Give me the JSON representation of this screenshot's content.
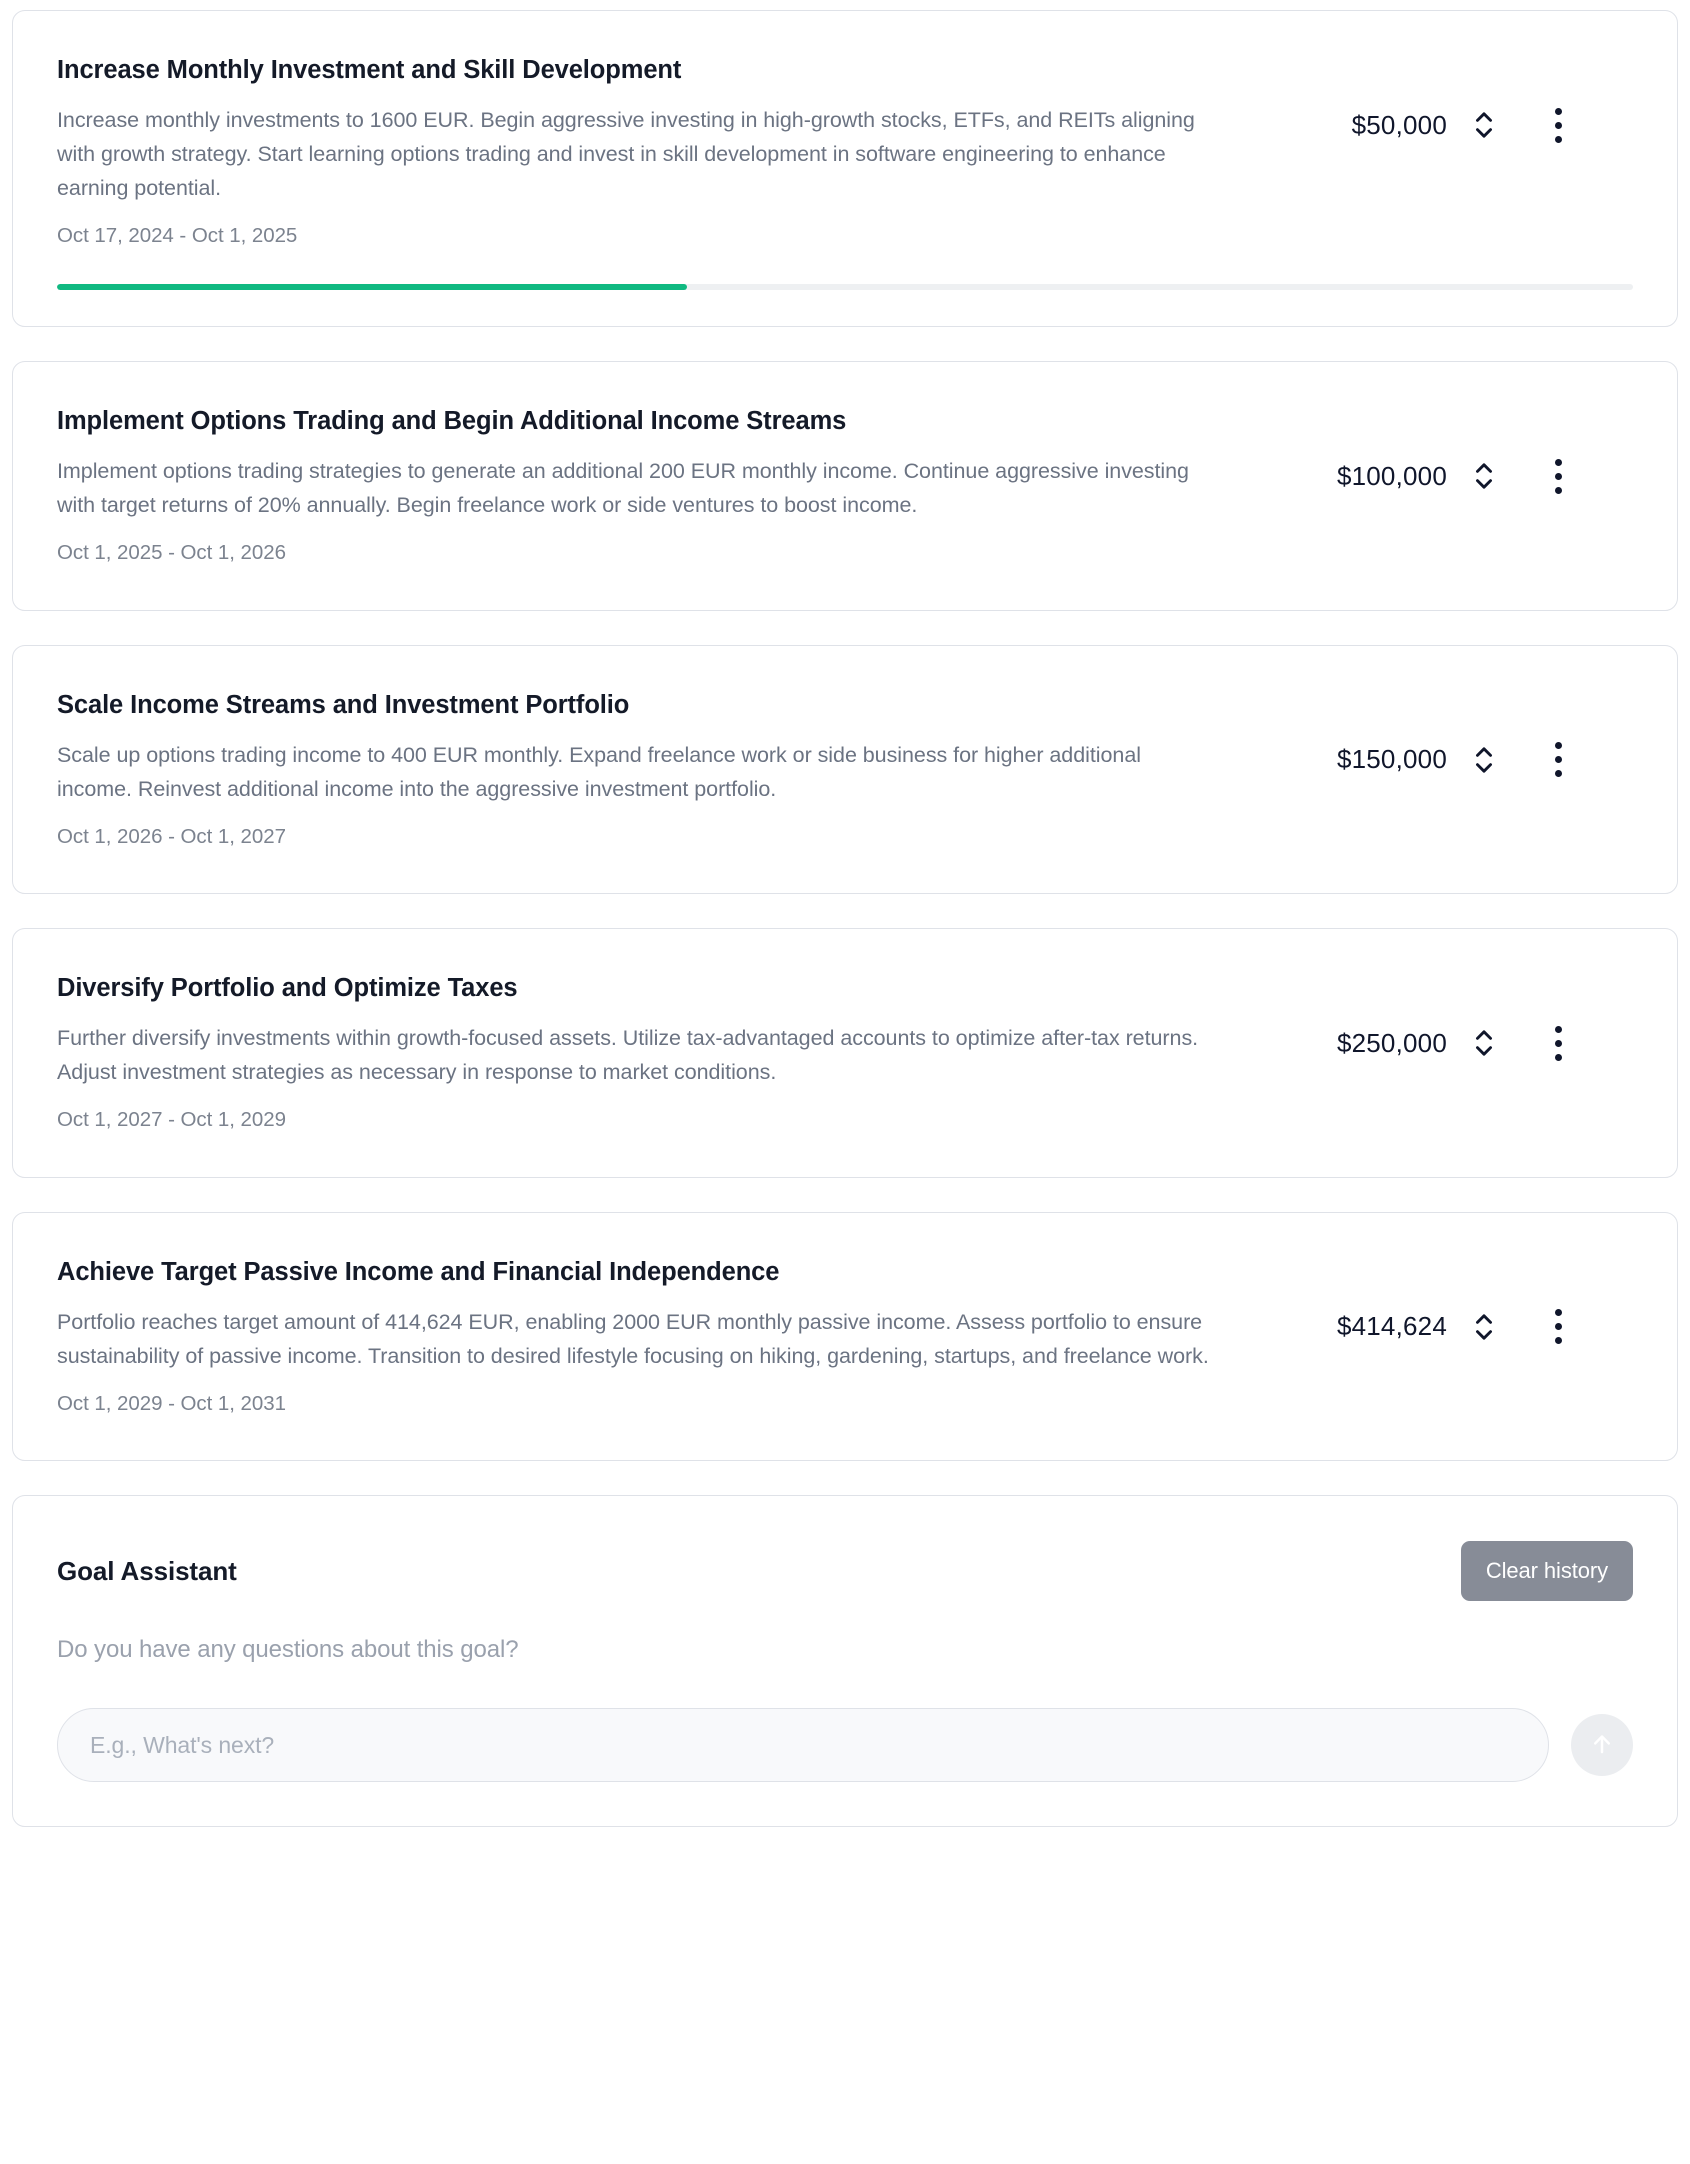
{
  "milestones": [
    {
      "title": "Increase Monthly Investment and Skill Development",
      "description": "Increase monthly investments to 1600 EUR. Begin aggressive investing in high-growth stocks, ETFs, and REITs aligning with growth strategy. Start learning options trading and invest in skill development in software engineering to enhance earning potential.",
      "dates": "Oct 17, 2024 - Oct 1, 2025",
      "amount": "$50,000",
      "progress_percent": 40,
      "has_progress": true
    },
    {
      "title": "Implement Options Trading and Begin Additional Income Streams",
      "description": "Implement options trading strategies to generate an additional 200 EUR monthly income. Continue aggressive investing with target returns of 20% annually. Begin freelance work or side ventures to boost income.",
      "dates": "Oct 1, 2025 - Oct 1, 2026",
      "amount": "$100,000",
      "progress_percent": 0,
      "has_progress": false
    },
    {
      "title": "Scale Income Streams and Investment Portfolio",
      "description": "Scale up options trading income to 400 EUR monthly. Expand freelance work or side business for higher additional income. Reinvest additional income into the aggressive investment portfolio.",
      "dates": "Oct 1, 2026 - Oct 1, 2027",
      "amount": "$150,000",
      "progress_percent": 0,
      "has_progress": false
    },
    {
      "title": "Diversify Portfolio and Optimize Taxes",
      "description": "Further diversify investments within growth-focused assets. Utilize tax-advantaged accounts to optimize after-tax returns. Adjust investment strategies as necessary in response to market conditions.",
      "dates": "Oct 1, 2027 - Oct 1, 2029",
      "amount": "$250,000",
      "progress_percent": 0,
      "has_progress": false
    },
    {
      "title": "Achieve Target Passive Income and Financial Independence",
      "description": "Portfolio reaches target amount of 414,624 EUR, enabling 2000 EUR monthly passive income. Assess portfolio to ensure sustainability of passive income. Transition to desired lifestyle focusing on hiking, gardening, startups, and freelance work.",
      "dates": "Oct 1, 2029 - Oct 1, 2031",
      "amount": "$414,624",
      "progress_percent": 0,
      "has_progress": false
    }
  ],
  "assistant": {
    "title": "Goal Assistant",
    "clear_label": "Clear history",
    "prompt": "Do you have any questions about this goal?",
    "input_value": "",
    "input_placeholder": "E.g., What's next?",
    "send_icon": "arrow-up-icon",
    "expand_icon": "chevron-up-down-icon",
    "menu_icon": "more-vertical-icon"
  },
  "colors": {
    "progress_fill": "#10b981",
    "progress_track": "#eef0f2",
    "card_border": "#dfe2e8",
    "clear_button": "#878c97"
  }
}
